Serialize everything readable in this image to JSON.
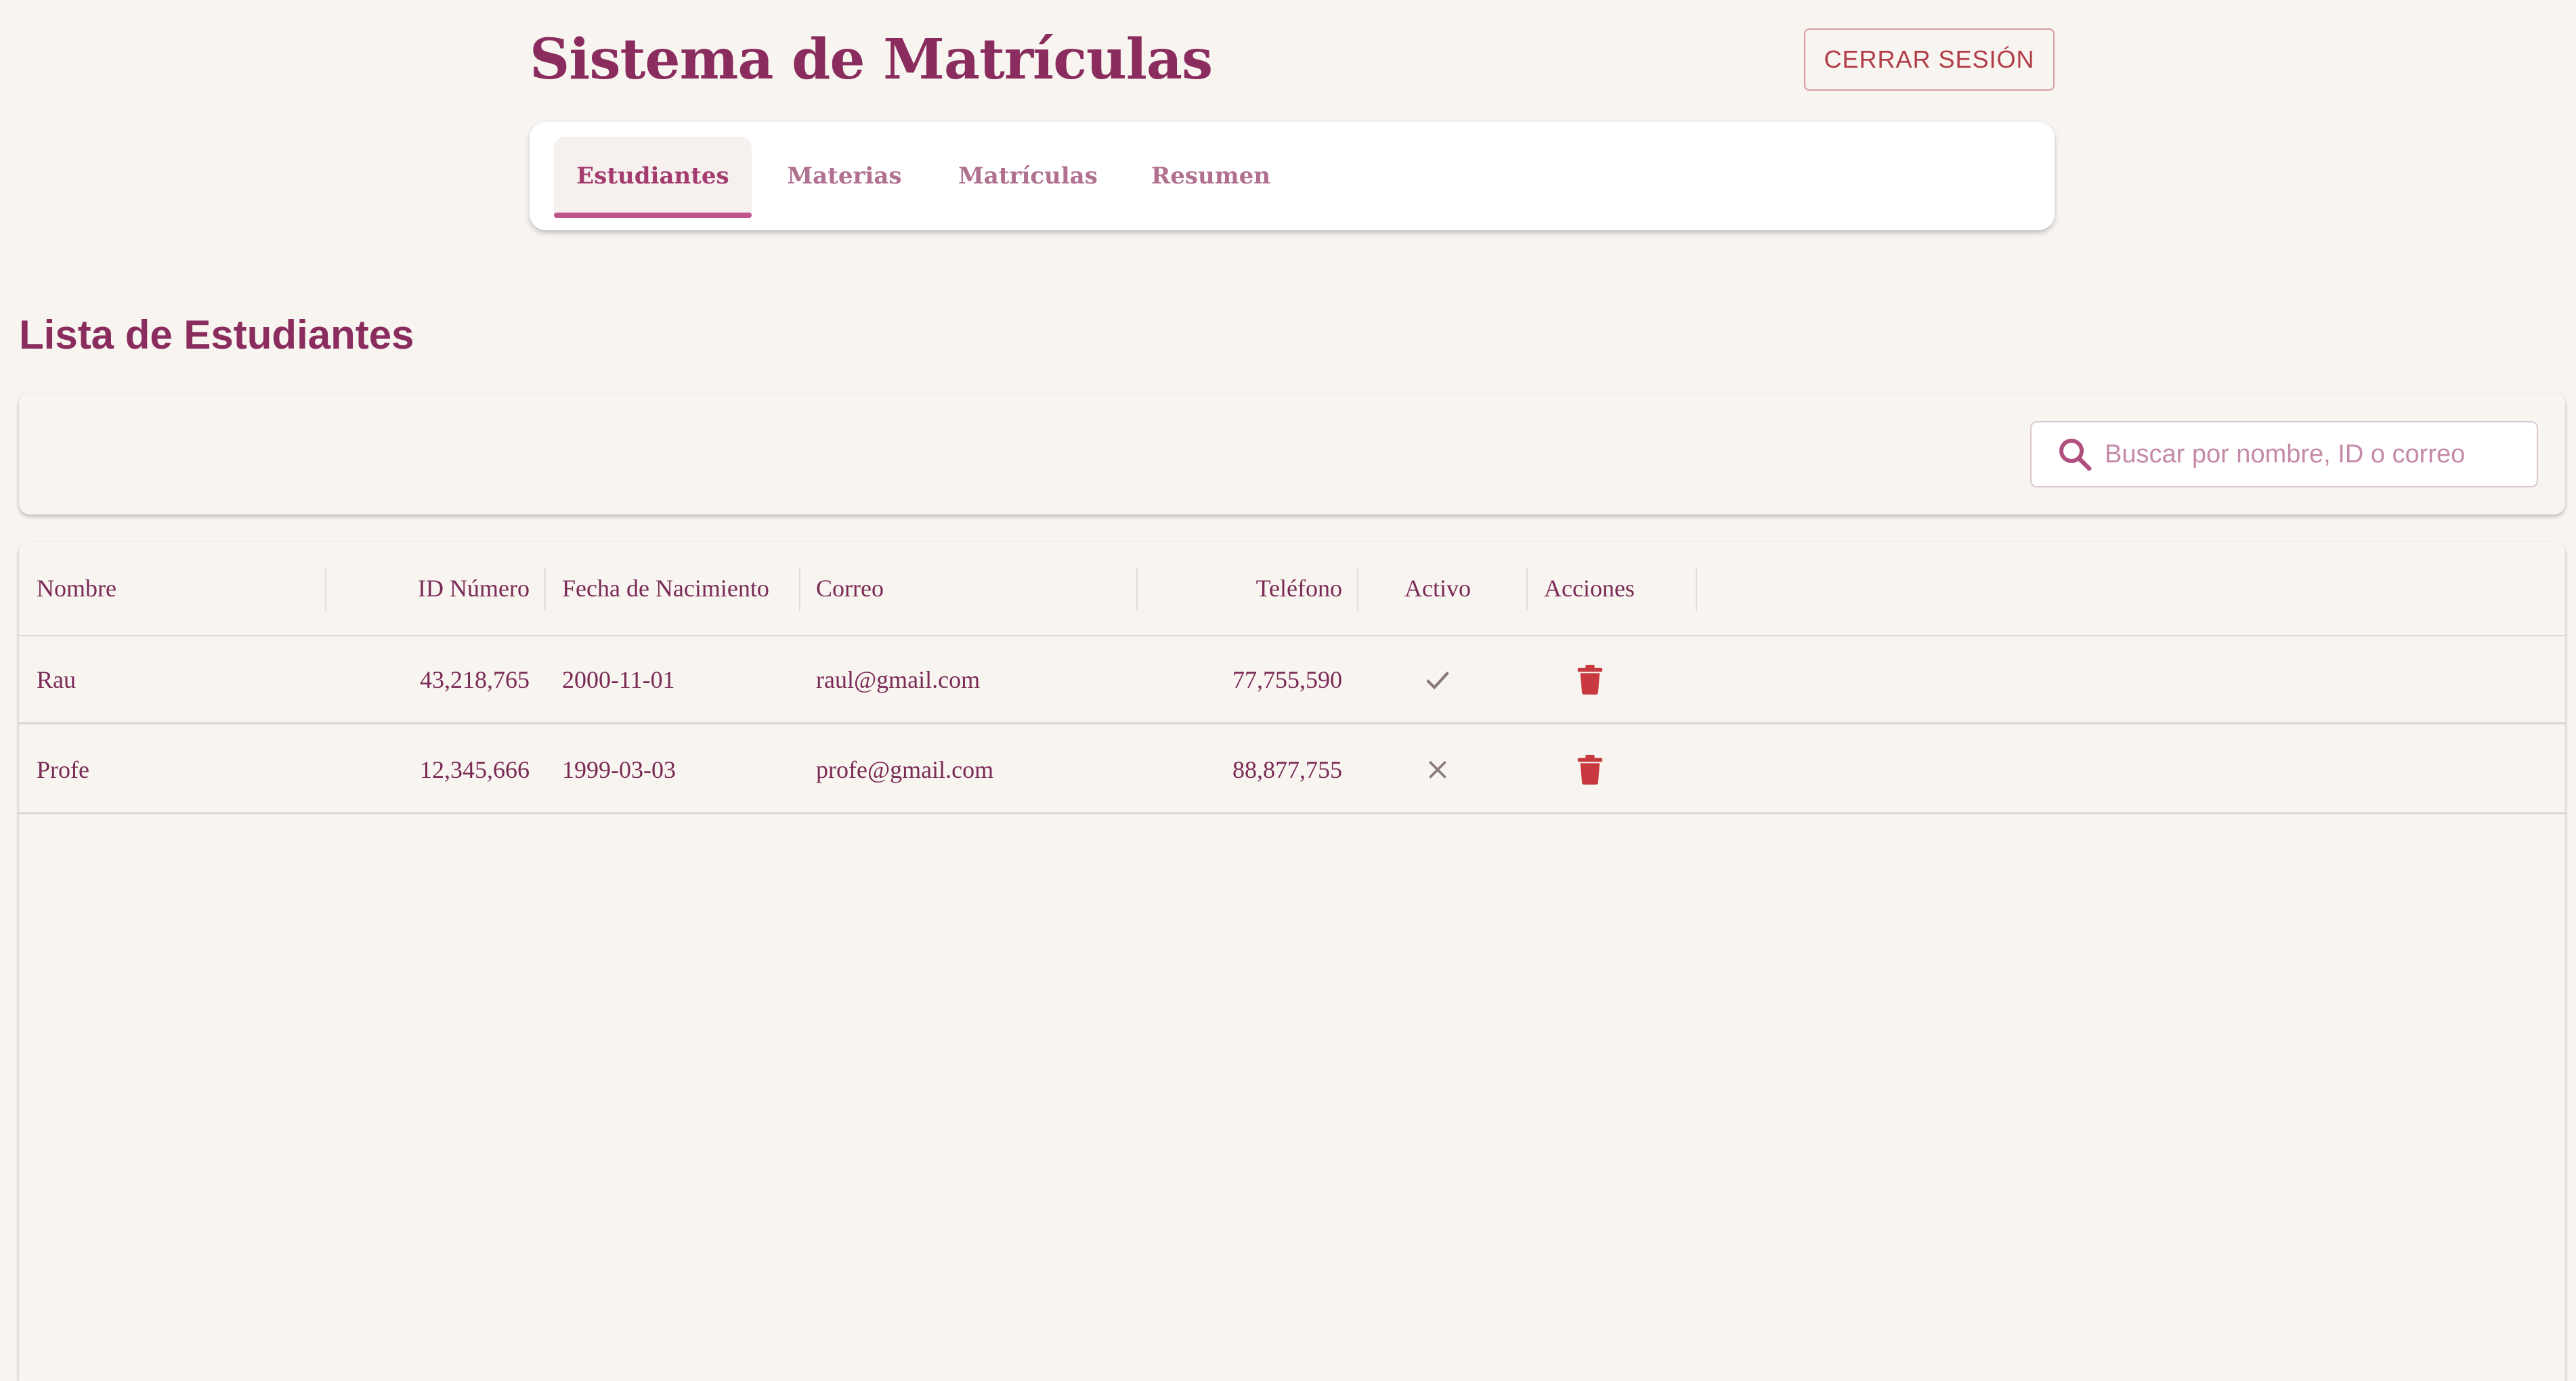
{
  "header": {
    "title": "Sistema de Matrículas",
    "logout_label": "CERRAR SESIÓN"
  },
  "tabs": [
    {
      "label": "Estudiantes",
      "active": true
    },
    {
      "label": "Materias",
      "active": false
    },
    {
      "label": "Matrículas",
      "active": false
    },
    {
      "label": "Resumen",
      "active": false
    }
  ],
  "section": {
    "title": "Lista de Estudiantes"
  },
  "search": {
    "placeholder": "Buscar por nombre, ID o correo",
    "value": "",
    "icon": "search-icon"
  },
  "table": {
    "columns": [
      "Nombre",
      "ID Número",
      "Fecha de Nacimiento",
      "Correo",
      "Teléfono",
      "Activo",
      "Acciones"
    ],
    "rows": [
      {
        "nombre": "Rau",
        "id": "43,218,765",
        "fecha": "2000-11-01",
        "correo": "raul@gmail.com",
        "telefono": "77,755,590",
        "activo": true,
        "activo_icon": "check-icon",
        "accion_icon": "trash-icon"
      },
      {
        "nombre": "Profe",
        "id": "12,345,666",
        "fecha": "1999-03-03",
        "correo": "profe@gmail.com",
        "telefono": "88,877,755",
        "activo": false,
        "activo_icon": "close-icon",
        "accion_icon": "trash-icon"
      }
    ]
  },
  "colors": {
    "brand": "#8a2d5e",
    "accent": "#c0558b",
    "danger": "#c83a3f",
    "background": "#f8f5f1"
  }
}
